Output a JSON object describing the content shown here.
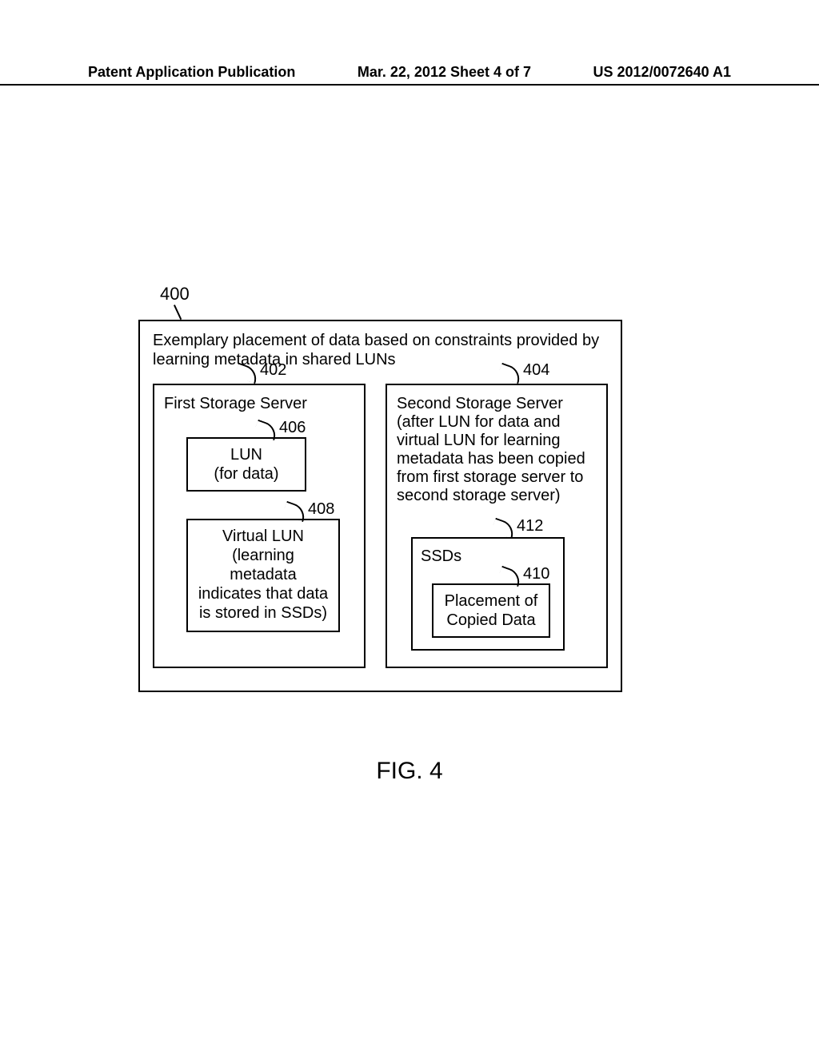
{
  "header": {
    "left": "Patent Application Publication",
    "center": "Mar. 22, 2012  Sheet 4 of 7",
    "right": "US 2012/0072640 A1"
  },
  "figure": {
    "ref_top": "400",
    "title": "Exemplary placement of data based on constraints provided by learning metadata in shared LUNs",
    "caption": "FIG. 4",
    "left_server": {
      "label": "First Storage Server",
      "callout": "402",
      "lun": {
        "line1": "LUN",
        "line2": "(for data)",
        "callout": "406"
      },
      "vlun": {
        "line1": "Virtual LUN",
        "line2": "(learning",
        "line3": "metadata",
        "line4": "indicates that data",
        "line5": "is stored in SSDs)",
        "callout": "408"
      }
    },
    "right_server": {
      "label": "Second Storage Server (after LUN for data and virtual LUN for learning metadata has been copied from first storage server to second storage server)",
      "callout": "404",
      "ssd": {
        "title": "SSDs",
        "callout": "412",
        "placement": {
          "line1": "Placement of",
          "line2": "Copied Data",
          "callout": "410"
        }
      }
    }
  }
}
